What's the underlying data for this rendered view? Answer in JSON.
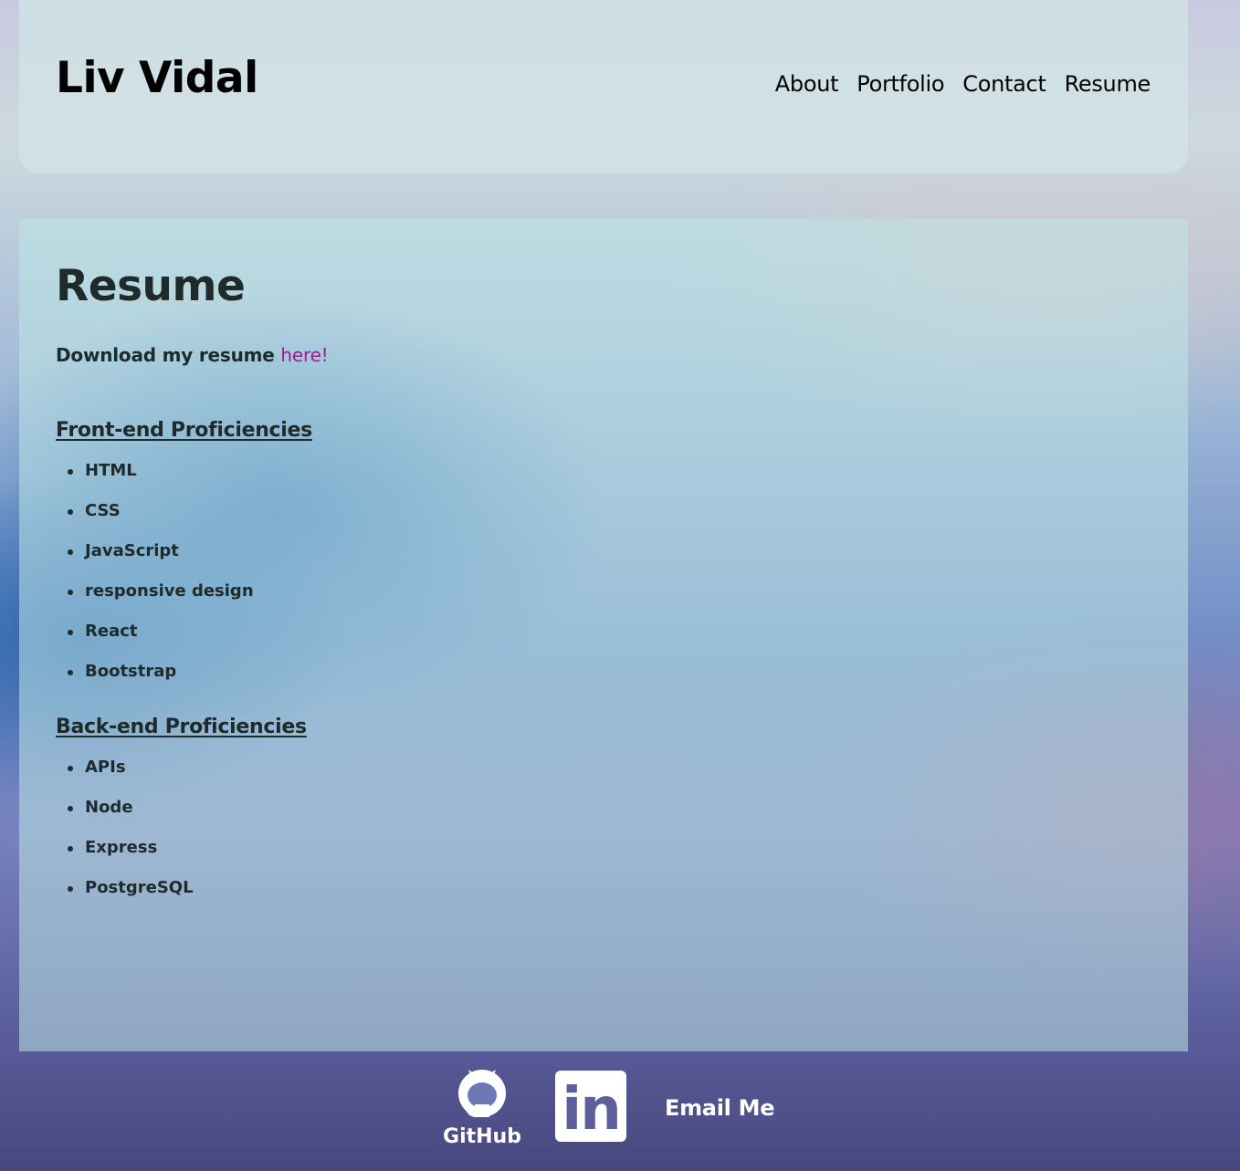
{
  "header": {
    "site_title": "Liv Vidal",
    "nav": [
      {
        "label": "About"
      },
      {
        "label": "Portfolio"
      },
      {
        "label": "Contact"
      },
      {
        "label": "Resume"
      }
    ]
  },
  "main": {
    "heading": "Resume",
    "download_text": "Download my resume ",
    "download_link": "here!",
    "front_end": {
      "heading": "Front-end Proficiencies",
      "items": [
        "HTML",
        "CSS",
        "JavaScript",
        "responsive design",
        "React",
        "Bootstrap"
      ]
    },
    "back_end": {
      "heading": "Back-end Proficiencies",
      "items": [
        "APIs",
        "Node",
        "Express",
        "PostgreSQL"
      ]
    }
  },
  "footer": {
    "github_label": "GitHub",
    "linkedin_label": "in",
    "email_label": "Email Me",
    "icons": [
      "github-icon",
      "linkedin-icon"
    ]
  },
  "colors": {
    "link_accent": "#a01896",
    "text_dark": "#1f2a2a",
    "header_bg": "rgba(210,228,232,0.72)"
  }
}
